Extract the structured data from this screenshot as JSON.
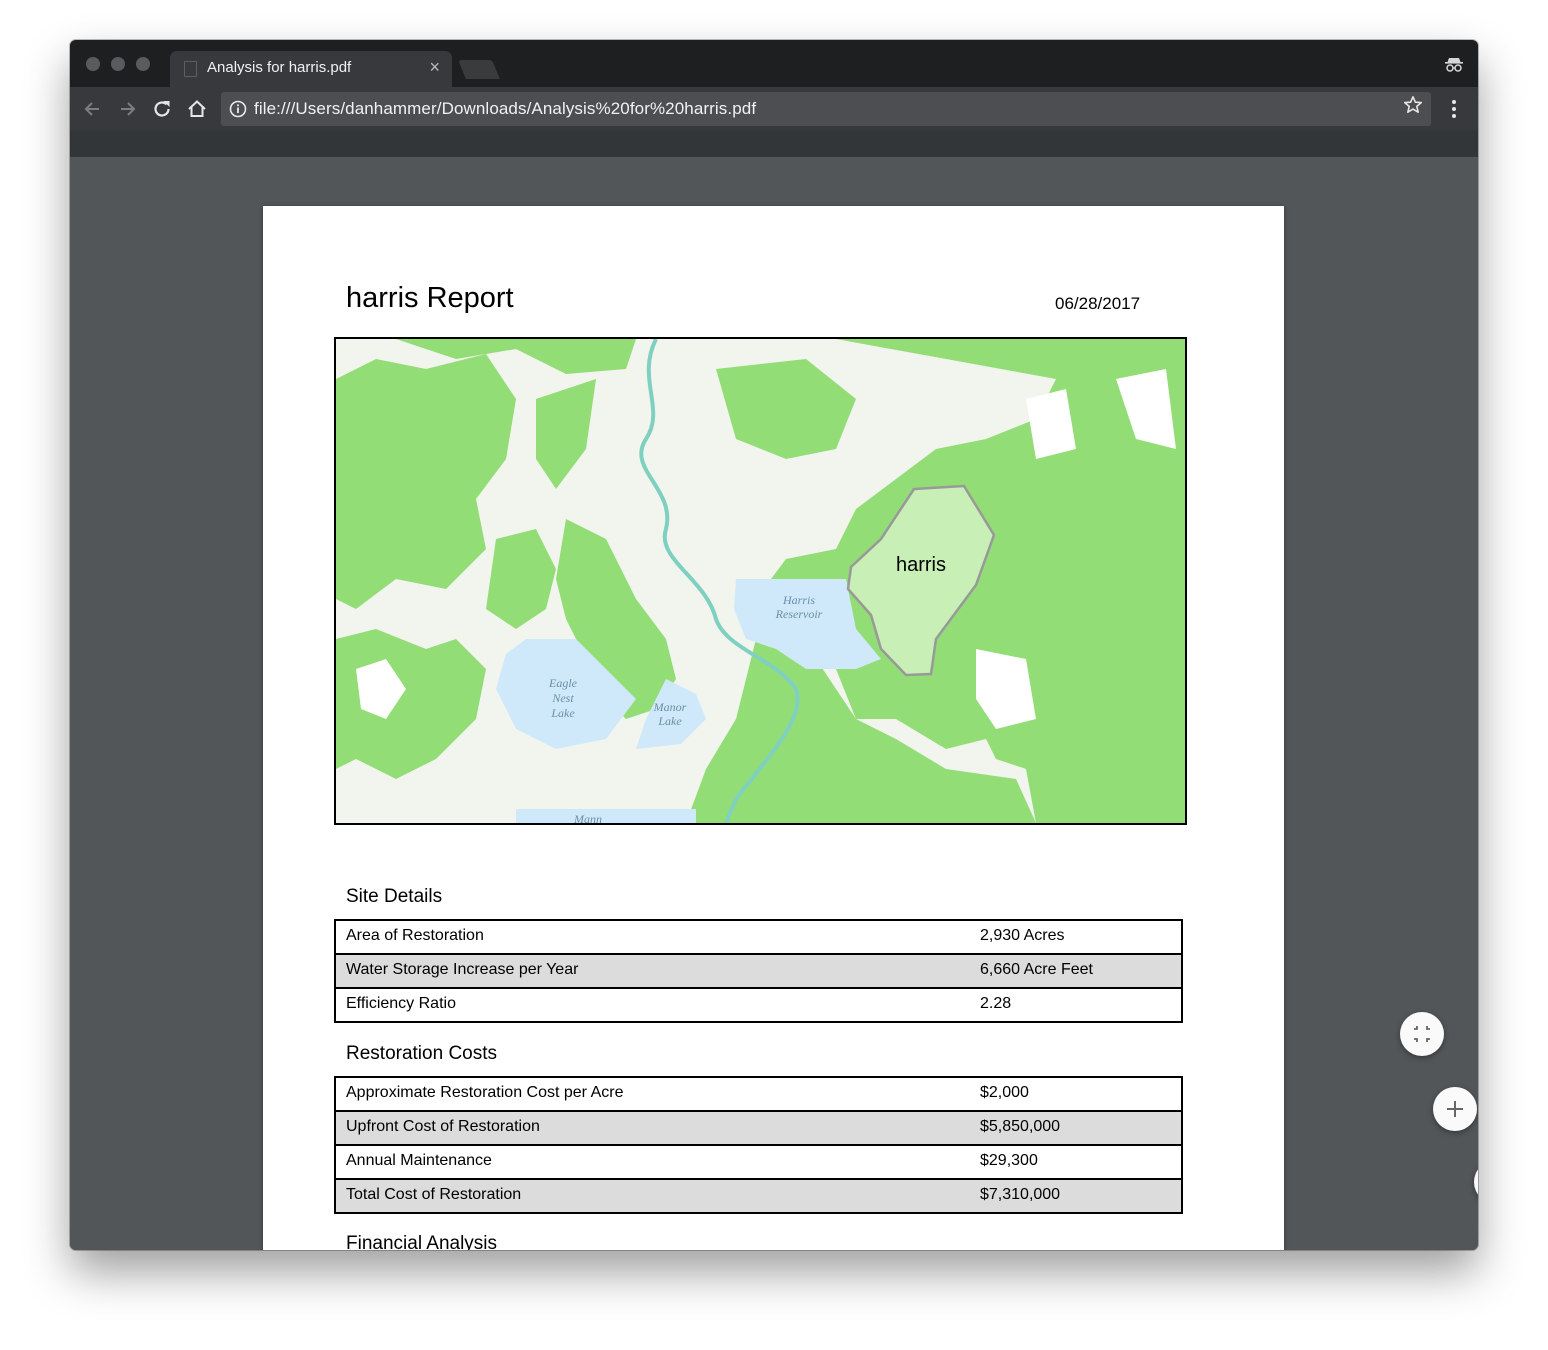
{
  "browser": {
    "tab_title": "Analysis for harris.pdf",
    "tab_close": "×",
    "url": "file:///Users/danhammer/Downloads/Analysis%20for%20harris.pdf",
    "icons": [
      "back-icon",
      "forward-icon",
      "reload-icon",
      "home-icon",
      "info-icon",
      "star-icon",
      "menu-icon",
      "incognito-icon"
    ]
  },
  "report": {
    "title": "harris Report",
    "date": "06/28/2017",
    "map": {
      "polygon_label": "harris",
      "lakes": {
        "harris_1": "Harris",
        "harris_2": "Reservoir",
        "eagle_1": "Eagle",
        "eagle_2": "Nest",
        "eagle_3": "Lake",
        "manor_1": "Manor",
        "manor_2": "Lake",
        "mann": "Mann"
      }
    },
    "site_details": {
      "heading": "Site Details",
      "rows": [
        {
          "label": "Area of Restoration",
          "value": "2,930 Acres"
        },
        {
          "label": "Water Storage Increase per Year",
          "value": "6,660 Acre Feet"
        },
        {
          "label": "Efficiency Ratio",
          "value": "2.28"
        }
      ]
    },
    "restoration_costs": {
      "heading": "Restoration Costs",
      "rows": [
        {
          "label": "Approximate Restoration Cost per Acre",
          "value": "$2,000"
        },
        {
          "label": "Upfront Cost of Restoration",
          "value": "$5,850,000"
        },
        {
          "label": "Annual Maintenance",
          "value": "$29,300"
        },
        {
          "label": "Total Cost of Restoration",
          "value": "$7,310,000"
        }
      ]
    },
    "financial_analysis": {
      "heading": "Financial Analysis"
    }
  },
  "colors": {
    "forest": "#93dd76",
    "water": "#cfe9fb",
    "polygon_fill": "#c7efb6",
    "polygon_stroke": "#999999",
    "viewer_bg": "#525659"
  }
}
